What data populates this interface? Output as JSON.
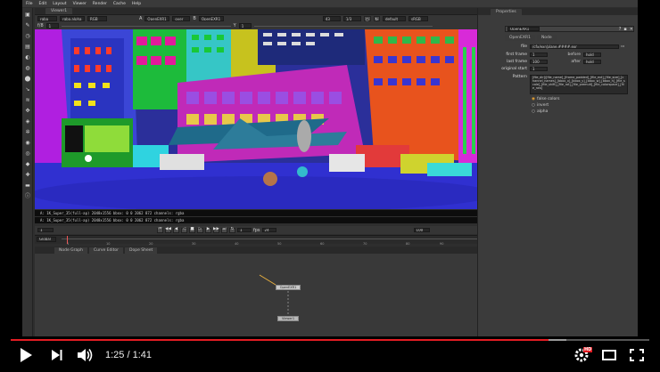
{
  "menu": [
    "File",
    "Edit",
    "Layout",
    "Viewer",
    "Render",
    "Cache",
    "Help"
  ],
  "viewer": {
    "tab_label": "Viewer1",
    "channels": "rgba",
    "channel_alpha": "rgba.alpha",
    "colorspace": "RGB",
    "input_a_label": "A",
    "input_a": "OpenEXR1",
    "op": "over",
    "input_b_label": "B",
    "input_b": "OpenEXR1",
    "zoom": "43",
    "proxy": "1/3",
    "lut": "default",
    "lut2": "sRGB",
    "frame_label": "f/8",
    "gain": "1",
    "gamma": "1",
    "y_label": "Y",
    "info_line_1": "A: 1K_Super_35(full-ap) 2048x1556 bbox: 0 0 2062 872 channels: rgba",
    "info_line_2": "A: 1K_Super_35(full-ap) 2048x1556 bbox: 0 0 2062 872 channels: rgba",
    "current_frame": "1",
    "fps_label": "fps",
    "fps": "24",
    "in_frame": "1",
    "out_frame": "100",
    "global_label": "Global",
    "timeline_ticks": [
      "1",
      "10",
      "20",
      "30",
      "40",
      "50",
      "60",
      "70",
      "80",
      "90",
      "100"
    ]
  },
  "graph": {
    "tabs": [
      "Node Graph",
      "Curve Editor",
      "Dope Sheet"
    ],
    "node_read": "OpenEXR1",
    "node_viewer": "Viewer1"
  },
  "properties": {
    "title": "Properties",
    "node_name": "OpenEXR1",
    "tabs": [
      "OpenEXR1",
      "Node"
    ],
    "file_label": "file",
    "file_value": "/cfx/exr/plane.####.exr",
    "first_frame_label": "first frame",
    "first_frame": "1",
    "before_label": "before",
    "before_value": "hold",
    "last_frame_label": "last frame",
    "last_frame": "100",
    "after_label": "after",
    "after_value": "hold",
    "original_start_label": "original start",
    "original_start": "1",
    "pattern_label": "Pattern",
    "pattern_text": "[file_dir]/[file_name]_[frame_padded]_[file_ext]_[file_size]_[channel_names]_[bbox_x]_[bbox_y]_[bbox_w]_[bbox_h]_[file_scale]_[file_shift]_[file_rot]_[file_premult]_[file_colorspace]_[file_raw]",
    "radio_options": [
      "false colors",
      "invert",
      "alpha"
    ]
  },
  "player": {
    "time_current": "1:25",
    "time_total": "1:41",
    "time_display": "1:25 / 1:41",
    "progress_fraction": 0.842,
    "buffered_fraction": 0.87,
    "hd_badge": "HD",
    "accent": "#e31c23"
  },
  "icons": [
    "play-icon",
    "next-icon",
    "volume-icon",
    "settings-icon",
    "theater-icon",
    "fullscreen-icon"
  ]
}
